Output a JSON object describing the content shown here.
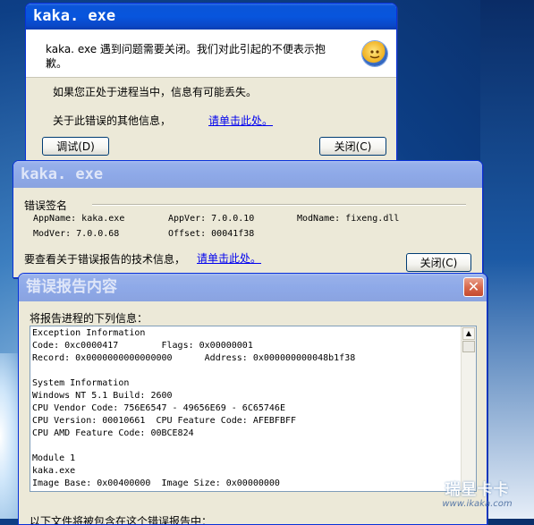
{
  "window1": {
    "title": "kaka. exe",
    "message": "kaka. exe 遇到问题需要关闭。我们对此引起的不便表示抱歉。",
    "info_loss": "如果您正处于进程当中，信息有可能丢失。",
    "more_info_label": "关于此错误的其他信息，",
    "more_info_link": "请单击此处。",
    "debug_button": "调试(D)",
    "close_button": "关闭(C)"
  },
  "window2": {
    "title": "kaka. exe",
    "section_title": "错误签名",
    "sig_row1": [
      "AppName: kaka.exe",
      "AppVer: 7.0.0.10",
      "ModName: fixeng.dll"
    ],
    "sig_row2": [
      "ModVer: 7.0.0.68",
      "Offset: 00041f38"
    ],
    "tech_info_label": "要查看关于错误报告的技术信息，",
    "tech_info_link": "请单击此处。",
    "close_button": "关闭(C)"
  },
  "window3": {
    "title": "错误报告内容",
    "intro": "将报告进程的下列信息：",
    "report_lines": [
      "Exception Information",
      "Code: 0xc0000417        Flags: 0x00000001",
      "Record: 0x0000000000000000      Address: 0x000000000048b1f38",
      "",
      "System Information",
      "Windows NT 5.1 Build: 2600",
      "CPU Vendor Code: 756E6547 - 49656E69 - 6C65746E",
      "CPU Version: 00010661  CPU Feature Code: AFEBFBFF",
      "CPU AMD Feature Code: 00BCE824",
      "",
      "Module 1",
      "kaka.exe",
      "Image Base: 0x00400000  Image Size: 0x00000000"
    ],
    "footer_partial": "以下文件将被包含在这个错误报告中："
  },
  "watermark": {
    "brand": "瑞星卡卡",
    "url": "www.ikaka.com"
  }
}
